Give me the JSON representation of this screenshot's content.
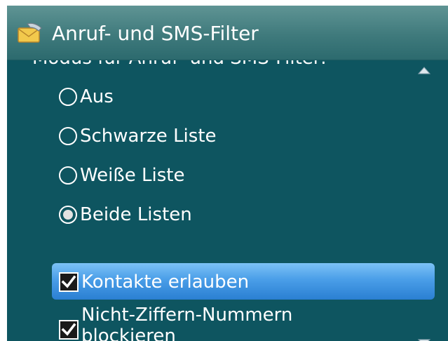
{
  "window": {
    "title": "Anruf- und SMS-Filter",
    "icon": "envelope-phone-icon"
  },
  "mode_section": {
    "label": "Modus für Anruf- und SMS-Filter:",
    "options": [
      {
        "label": "Aus",
        "selected": false
      },
      {
        "label": "Schwarze Liste",
        "selected": false
      },
      {
        "label": "Weiße Liste",
        "selected": false
      },
      {
        "label": "Beide Listen",
        "selected": true
      }
    ]
  },
  "settings": [
    {
      "label": "Kontakte erlauben",
      "checked": true,
      "focused": true
    },
    {
      "label_line1": "Nicht-Ziffern-Nummern",
      "label_line2": "blockieren",
      "checked": true,
      "focused": false
    }
  ],
  "colors": {
    "background": "#0e5560",
    "titlebar": "#3f7a7c",
    "focus_highlight": "#4a9ee8",
    "text": "#ffffff"
  }
}
